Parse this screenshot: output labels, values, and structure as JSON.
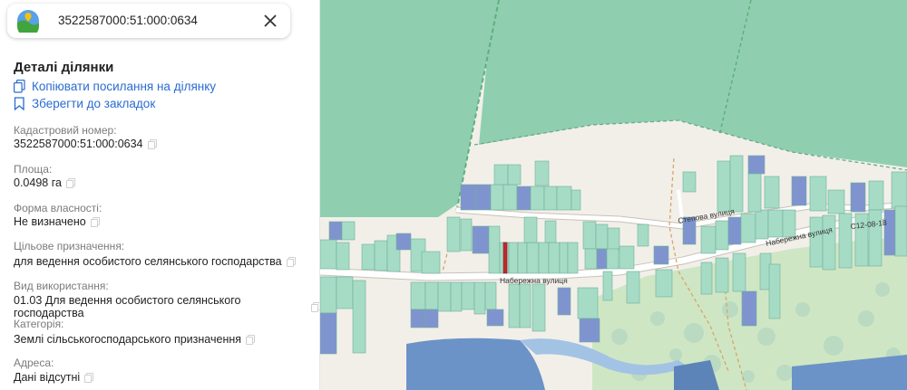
{
  "search": {
    "value": "3522587000:51:000:0634"
  },
  "details": {
    "title": "Деталі ділянки",
    "copy_link_label": "Копіювати посилання на ділянку",
    "bookmark_label": "Зберегти до закладок"
  },
  "fields": [
    {
      "label": "Кадастровий номер:",
      "value": "3522587000:51:000:0634"
    },
    {
      "label": "Площа:",
      "value": "0.0498 га"
    },
    {
      "label": "Форма власності:",
      "value": "Не визначено"
    },
    {
      "label": "Цільове призначення:",
      "value": "для ведення особистого селянського господарства"
    },
    {
      "label": "Вид використання:",
      "value": "01.03 Для ведення особистого селянського господарства"
    },
    {
      "label": "Категорія:",
      "value": "Землі сільськогосподарського призначення"
    },
    {
      "label": "Адреса:",
      "value": "Дані відсутні"
    }
  ],
  "map": {
    "street_labels": [
      "Набережна вулиця",
      "Набережна вулиця",
      "Степова вулиця",
      "С12-08-18"
    ],
    "colors": {
      "background": "#f2efe9",
      "field": "#8fcfb0",
      "parcel_green": "#a6dcc6",
      "parcel_blue": "#7f94cf",
      "selected": "#c0282d",
      "water": "#6b93c7",
      "forest": "#cfe6c4"
    }
  }
}
